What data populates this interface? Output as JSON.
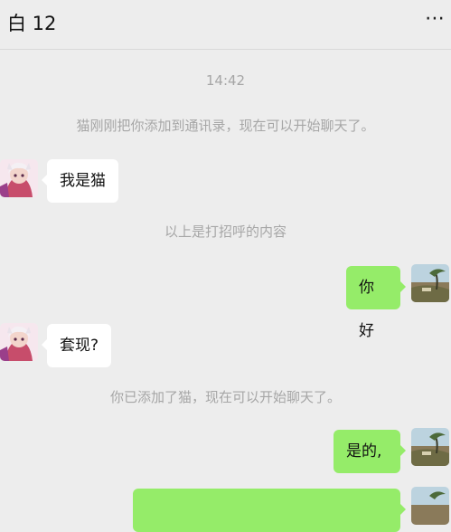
{
  "header": {
    "title": "白 12",
    "more_icon": "⋯"
  },
  "messages": {
    "time": "14:42",
    "added_notice": "猫刚刚把你添加到通讯录，现在可以开始聊天了。",
    "msg1": "我是猫",
    "greeting_notice": "以上是打招呼的内容",
    "msg2": "你好",
    "msg3": "套现?",
    "you_added_notice": "你已添加了猫，现在可以开始聊天了。",
    "msg4": "是的,",
    "msg5": ""
  },
  "colors": {
    "background": "#ededed",
    "incoming_bubble": "#ffffff",
    "outgoing_bubble": "#95ec69",
    "system_text": "#a6a6a6"
  },
  "icons": {
    "contact_avatar": "anime-character-avatar",
    "self_avatar": "landscape-photo-avatar"
  }
}
